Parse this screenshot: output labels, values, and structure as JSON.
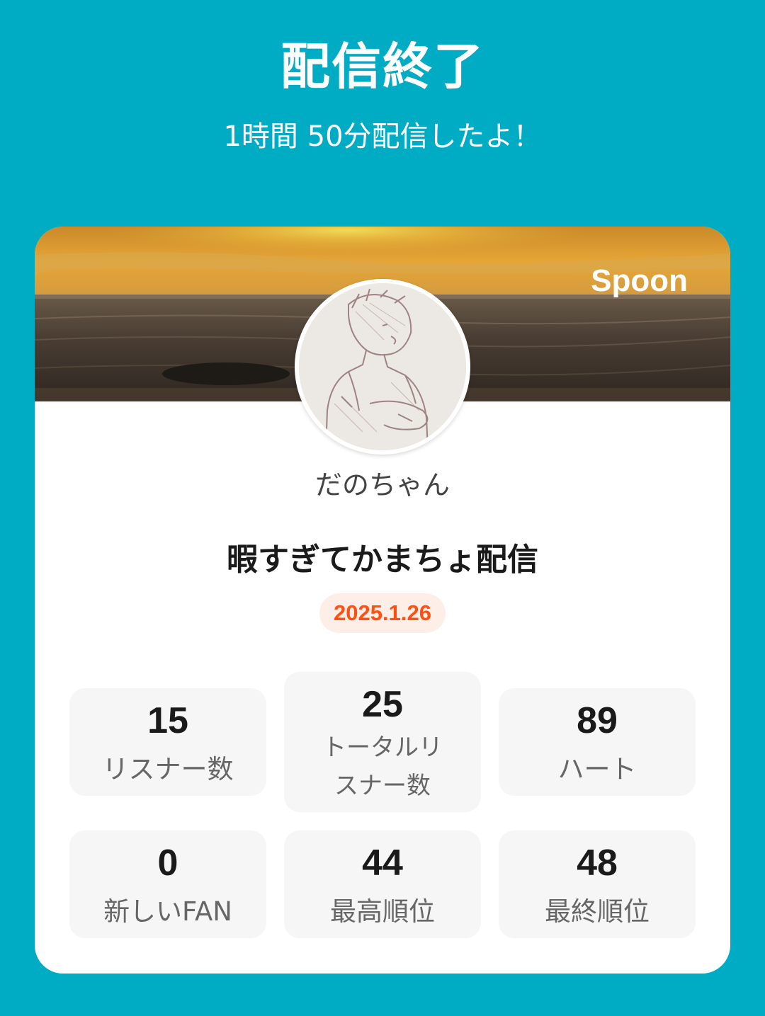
{
  "header": {
    "title": "配信終了",
    "subtitle": "1時間 50分配信したよ！"
  },
  "card": {
    "brand": "Spoon",
    "host_name": "だのちゃん",
    "stream_title": "暇すぎてかまちょ配信",
    "date": "2025.1.26",
    "stats": [
      {
        "value": "15",
        "label": "リスナー数"
      },
      {
        "value": "25",
        "label": "トータルリスナー数"
      },
      {
        "value": "89",
        "label": "ハート"
      },
      {
        "value": "0",
        "label": "新しいFAN"
      },
      {
        "value": "44",
        "label": "最高順位"
      },
      {
        "value": "48",
        "label": "最終順位"
      }
    ]
  },
  "colors": {
    "background": "#00abc4",
    "date_accent": "#ff4f12",
    "date_badge_bg": "#fdeee8"
  }
}
